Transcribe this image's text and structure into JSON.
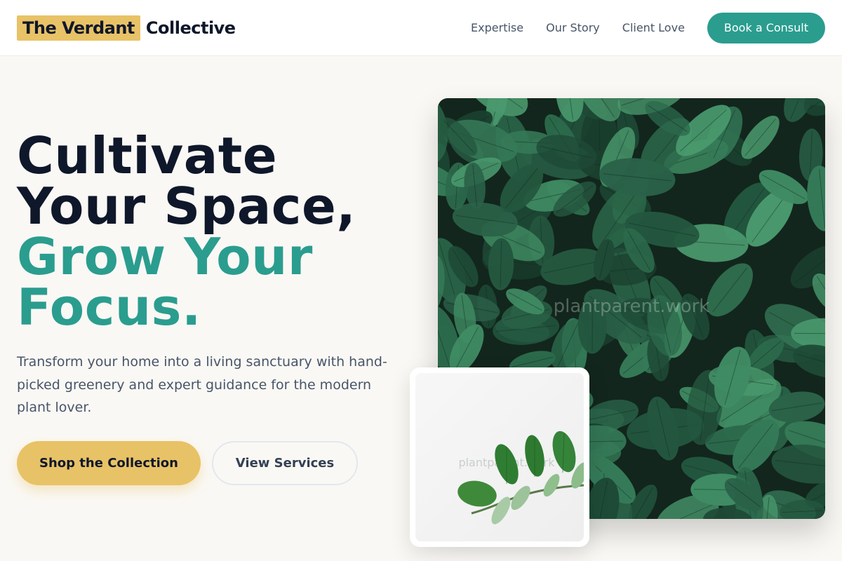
{
  "brand": {
    "highlight": "The Verdant",
    "rest": "Collective"
  },
  "nav": {
    "links": [
      "Expertise",
      "Our Story",
      "Client Love"
    ],
    "cta": "Book a Consult"
  },
  "hero": {
    "headline_dark": [
      "Cultivate",
      "Your Space,"
    ],
    "headline_teal": [
      "Grow Your",
      "Focus."
    ],
    "lead": "Transform your home into a living sanctuary with hand-picked greenery and expert guidance for the modern plant lover.",
    "primary_button": "Shop the Collection",
    "secondary_button": "View Services"
  },
  "images": {
    "main_watermark": "plantparent.work",
    "small_watermark": "plantparent.work"
  },
  "colors": {
    "accent_teal": "#2a9d8f",
    "accent_yellow": "#e8c266",
    "text_dark": "#0f172a",
    "background": "#faf8f4"
  },
  "icons": {
    "main_image": "leaf-foliage-photo",
    "small_image": "leaf-sprig-photo"
  }
}
